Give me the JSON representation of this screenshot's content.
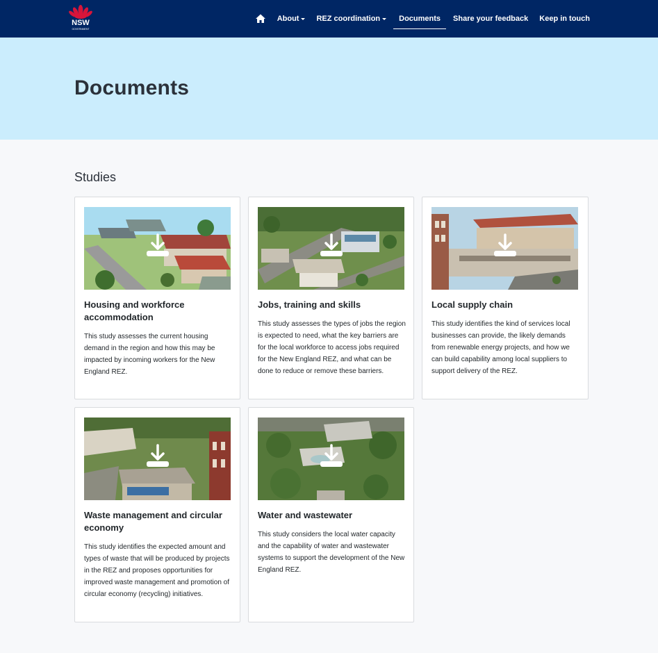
{
  "header": {
    "logo_text": "NSW",
    "logo_sub": "GOVERNMENT",
    "nav": [
      {
        "label": "About",
        "dropdown": true
      },
      {
        "label": "REZ coordination",
        "dropdown": true
      },
      {
        "label": "Documents",
        "active": true
      },
      {
        "label": "Share your feedback"
      },
      {
        "label": "Keep in touch"
      }
    ]
  },
  "hero": {
    "title": "Documents"
  },
  "studies": {
    "heading": "Studies",
    "cards": [
      {
        "title": "Housing and workforce accommodation",
        "description": "This study assesses the current housing demand in the region and how this may be impacted by incoming workers for the New England REZ.",
        "icon": "download-icon"
      },
      {
        "title": "Jobs, training and skills",
        "description": "This study assesses the types of jobs the region is expected to need, what the key barriers are for the local workforce to access jobs required for the New England REZ, and what can be done to reduce or remove these barriers.",
        "icon": "download-icon"
      },
      {
        "title": "Local supply chain",
        "description": "This study identifies the kind of services local businesses can provide, the likely demands from renewable energy projects, and how we can build capability among local suppliers to support delivery of the REZ.",
        "icon": "download-icon"
      },
      {
        "title": "Waste management and circular economy",
        "description": "This study identifies the expected amount and types of waste that will be produced by projects in the REZ and proposes opportunities for improved waste management and promotion of circular economy (recycling) initiatives.",
        "icon": "download-icon"
      },
      {
        "title": "Water and wastewater",
        "description": "This study considers the local water capacity and the capability of water and wastewater systems to support the development of the New England REZ.",
        "icon": "download-icon"
      }
    ]
  },
  "colors": {
    "navbar": "#002664",
    "hero": "#cbedfd",
    "waratah": "#d7153a",
    "page_bg": "#f7f8fa"
  }
}
